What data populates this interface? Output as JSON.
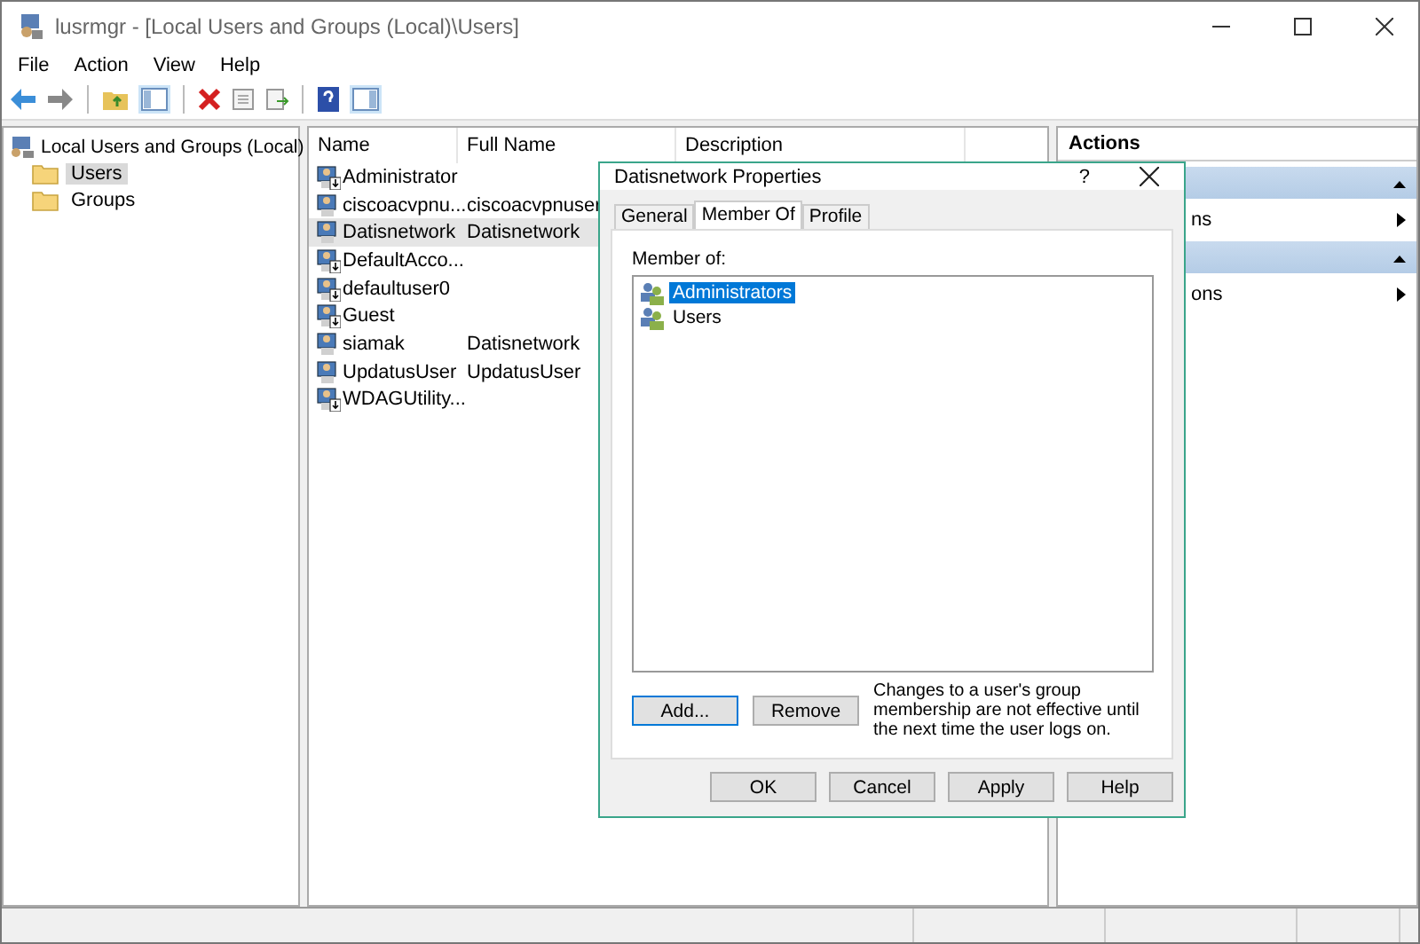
{
  "window": {
    "title": "lusrmgr - [Local Users and Groups (Local)\\Users]"
  },
  "menu": [
    "File",
    "Action",
    "View",
    "Help"
  ],
  "tree": {
    "label": "Local Users and Groups (Local)",
    "children": [
      {
        "label": "Users",
        "selected": true
      },
      {
        "label": "Groups",
        "selected": false
      }
    ]
  },
  "list": {
    "columns": [
      "Name",
      "Full Name",
      "Description"
    ],
    "rows": [
      {
        "name": "Administrator",
        "full_name": "",
        "disabled": true,
        "selected": false
      },
      {
        "name": "ciscoacvpnu...",
        "full_name": "ciscoacvpnuser",
        "disabled": false,
        "selected": false
      },
      {
        "name": "Datisnetwork",
        "full_name": "Datisnetwork",
        "disabled": false,
        "selected": true
      },
      {
        "name": "DefaultAcco...",
        "full_name": "",
        "disabled": true,
        "selected": false
      },
      {
        "name": "defaultuser0",
        "full_name": "",
        "disabled": true,
        "selected": false
      },
      {
        "name": "Guest",
        "full_name": "",
        "disabled": true,
        "selected": false
      },
      {
        "name": "siamak",
        "full_name": "Datisnetwork",
        "disabled": false,
        "selected": false
      },
      {
        "name": "UpdatusUser",
        "full_name": "UpdatusUser",
        "disabled": false,
        "selected": false
      },
      {
        "name": "WDAGUtility...",
        "full_name": "",
        "disabled": true,
        "selected": false
      }
    ]
  },
  "actions": {
    "title": "Actions",
    "items": [
      "ns",
      "ons"
    ]
  },
  "dialog": {
    "title": "Datisnetwork Properties",
    "help": "?",
    "tabs": [
      {
        "label": "General",
        "selected": false
      },
      {
        "label": "Member Of",
        "selected": true
      },
      {
        "label": "Profile",
        "selected": false
      }
    ],
    "member_of_label": "Member of:",
    "groups": [
      {
        "name": "Administrators",
        "selected": true
      },
      {
        "name": "Users",
        "selected": false
      }
    ],
    "add_button": "Add...",
    "remove_button": "Remove",
    "note": "Changes to a user's group membership are not effective until the next time the user logs on.",
    "buttons": [
      "OK",
      "Cancel",
      "Apply",
      "Help"
    ]
  }
}
